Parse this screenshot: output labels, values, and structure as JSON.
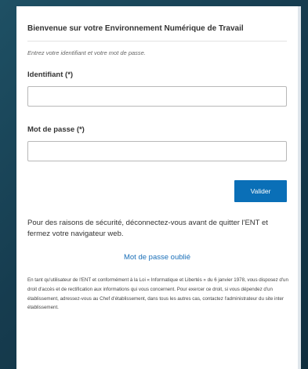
{
  "login": {
    "title": "Bienvenue sur votre Environnement Numérique de Travail",
    "hint": "Entrez votre identifiant et votre mot de passe.",
    "username_label": "Identifiant (*)",
    "username_value": "",
    "username_placeholder": "",
    "password_label": "Mot de passe (*)",
    "password_value": "",
    "password_placeholder": "",
    "submit_label": "Valider",
    "security_note": "Pour des raisons de sécurité, déconnectez-vous avant de quitter l'ENT et fermez votre navigateur web.",
    "forgot_link": "Mot de passe oublié",
    "legal_text": "En tant qu'utilisateur de l'ENT et conformément à la Loi « Informatique et Libertés » du 6 janvier 1978, vous disposez d'un droit d'accès et de rectification aux informations qui vous concernent. Pour exercer ce droit, si vous dépendez d'un établissement, adressez-vous au Chef d'établissement, dans tous les autres cas, contactez l'administrateur du site inter établissement."
  },
  "colors": {
    "background": "#163c4f",
    "button": "#0a6fb7",
    "link": "#1a6fb8"
  }
}
